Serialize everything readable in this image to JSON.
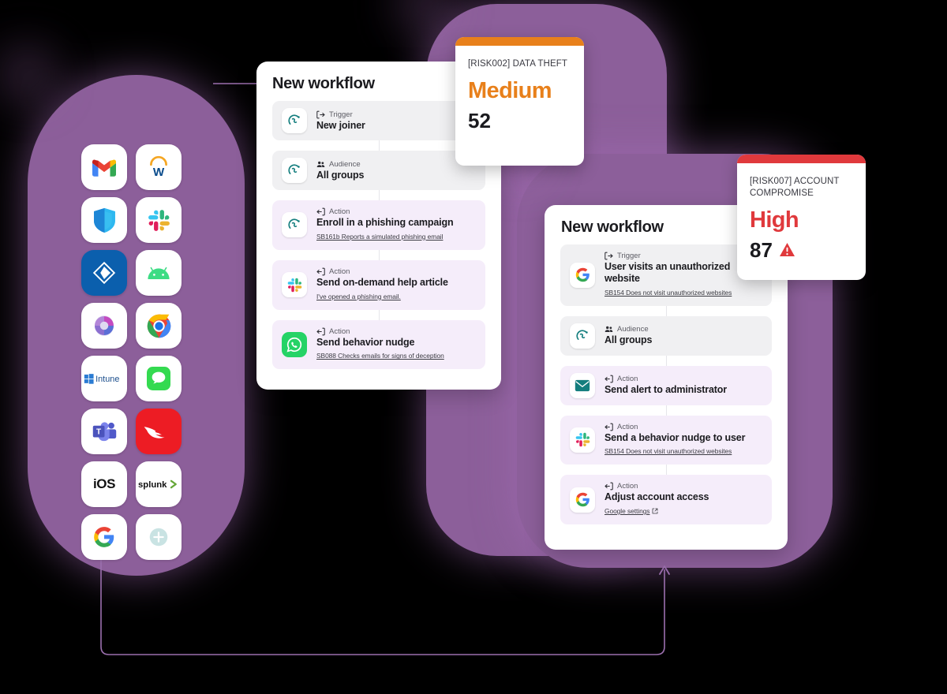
{
  "theme": {
    "purple": "#8C5F9A",
    "connector": "#9B6FAE",
    "medium_color": "#E8801B",
    "high_color": "#E0393C",
    "teal": "#147E7E"
  },
  "integrations": {
    "title": "integration-app-grid",
    "apps": [
      {
        "name": "gmail",
        "label": "Gmail"
      },
      {
        "name": "workday",
        "label": "Workday"
      },
      {
        "name": "microsoft-defender",
        "label": "Microsoft Defender"
      },
      {
        "name": "slack",
        "label": "Slack"
      },
      {
        "name": "active-directory",
        "label": "Active Directory"
      },
      {
        "name": "android",
        "label": "Android"
      },
      {
        "name": "microsoft-365",
        "label": "Microsoft 365"
      },
      {
        "name": "google-chrome",
        "label": "Google Chrome"
      },
      {
        "name": "microsoft-intune",
        "label": "Intune"
      },
      {
        "name": "apple-messages",
        "label": "Messages"
      },
      {
        "name": "microsoft-teams",
        "label": "Microsoft Teams"
      },
      {
        "name": "crowdstrike",
        "label": "CrowdStrike"
      },
      {
        "name": "ios",
        "label": "iOS"
      },
      {
        "name": "splunk",
        "label": "splunk"
      },
      {
        "name": "google",
        "label": "Google"
      },
      {
        "name": "add-integration",
        "label": "Add integration"
      }
    ]
  },
  "workflow_a": {
    "title": "New workflow",
    "steps": [
      {
        "kind": "Trigger",
        "kind_icon": "trigger-icon",
        "label": "New joiner",
        "sub": "",
        "sub_icon": "",
        "icon": "cultureai-icon",
        "tone": "grey"
      },
      {
        "kind": "Audience",
        "kind_icon": "audience-icon",
        "label": "All groups",
        "sub": "",
        "sub_icon": "",
        "icon": "cultureai-icon",
        "tone": "grey"
      },
      {
        "kind": "Action",
        "kind_icon": "action-icon",
        "label": "Enroll in a phishing campaign",
        "sub": "SB161b Reports a simulated phishing email",
        "sub_icon": "",
        "icon": "cultureai-icon",
        "tone": "purple"
      },
      {
        "kind": "Action",
        "kind_icon": "action-icon",
        "label": "Send on-demand help article",
        "sub": "I've opened a phishing email.",
        "sub_icon": "",
        "icon": "slack-icon",
        "tone": "purple"
      },
      {
        "kind": "Action",
        "kind_icon": "action-icon",
        "label": "Send behavior nudge",
        "sub": "SB088 Checks emails for signs of deception",
        "sub_icon": "",
        "icon": "whatsapp-icon",
        "tone": "purple"
      }
    ]
  },
  "workflow_b": {
    "title": "New workflow",
    "steps": [
      {
        "kind": "Trigger",
        "kind_icon": "trigger-icon",
        "label": "User visits an unauthorized website",
        "sub": "SB154 Does not visit unauthorized websites",
        "sub_icon": "",
        "icon": "google-icon",
        "tone": "grey"
      },
      {
        "kind": "Audience",
        "kind_icon": "audience-icon",
        "label": "All groups",
        "sub": "",
        "sub_icon": "",
        "icon": "cultureai-icon",
        "tone": "grey"
      },
      {
        "kind": "Action",
        "kind_icon": "action-icon",
        "label": "Send alert to administrator",
        "sub": "",
        "sub_icon": "",
        "icon": "email-icon",
        "tone": "purple"
      },
      {
        "kind": "Action",
        "kind_icon": "action-icon",
        "label": "Send a behavior nudge to user",
        "sub": "SB154 Does not visit unauthorized websites",
        "sub_icon": "",
        "icon": "slack-icon",
        "tone": "purple"
      },
      {
        "kind": "Action",
        "kind_icon": "action-icon",
        "label": "Adjust account access",
        "sub": "Google settings",
        "sub_icon": "external-link-icon",
        "icon": "google-icon",
        "tone": "purple"
      }
    ]
  },
  "risk_cards": [
    {
      "id": "[RISK002] DATA THEFT",
      "level": "Medium",
      "score": "52",
      "bar_color": "#E8801B",
      "level_color": "#E8801B",
      "warning": false
    },
    {
      "id": "[RISK007] ACCOUNT COMPROMISE",
      "level": "High",
      "score": "87",
      "bar_color": "#E0393C",
      "level_color": "#E0393C",
      "warning": true
    }
  ]
}
